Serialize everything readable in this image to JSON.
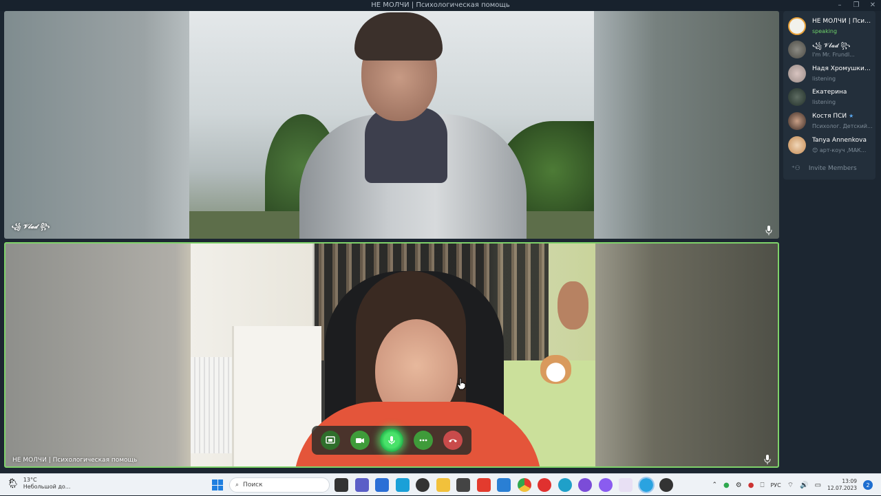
{
  "window": {
    "title": "НЕ МОЛЧИ | Психологическая помощь",
    "controls": [
      "minimize-icon",
      "restore-icon",
      "close-icon"
    ]
  },
  "tiles": {
    "top": {
      "name": "꧁ 𝓥𝓵𝓪𝓭 ꧂",
      "mic_icon": "microphone-icon"
    },
    "bottom": {
      "name": "НЕ МОЛЧИ | Психологическая помощь",
      "mic_icon": "microphone-icon",
      "active": true
    }
  },
  "controls": {
    "buttons": [
      "screen-share-icon",
      "video-camera-icon",
      "microphone-icon",
      "more-icon",
      "hang-up-icon"
    ],
    "colors": {
      "green": "#3f9b3a",
      "mic_glow": "#49e26a",
      "end_call": "#c94b4b"
    }
  },
  "participants": [
    {
      "name": "НЕ МОЛЧИ | Психологическая помощь",
      "status": "speaking",
      "speaking": true
    },
    {
      "name": "꧁ 𝓥𝓵𝓪𝓭 ꧂",
      "status": "I'm Mr. Frundl..."
    },
    {
      "name": "Надя Хромушкина",
      "status": "listening",
      "star": true
    },
    {
      "name": "Екатерина",
      "status": "listening"
    },
    {
      "name": "Костя ПСИ",
      "status": "Психолог. Детский...",
      "star": true
    },
    {
      "name": "Tanya Annenkova",
      "status": "😊 арт-коуч ,МАК..."
    }
  ],
  "invite_label": "Invite Members",
  "taskbar": {
    "weather_temp": "13°C",
    "weather_desc": "Небольшой до...",
    "search_placeholder": "Поиск",
    "language": "РУС",
    "time": "13:09",
    "date": "12.07.2023",
    "notifications": "2"
  }
}
